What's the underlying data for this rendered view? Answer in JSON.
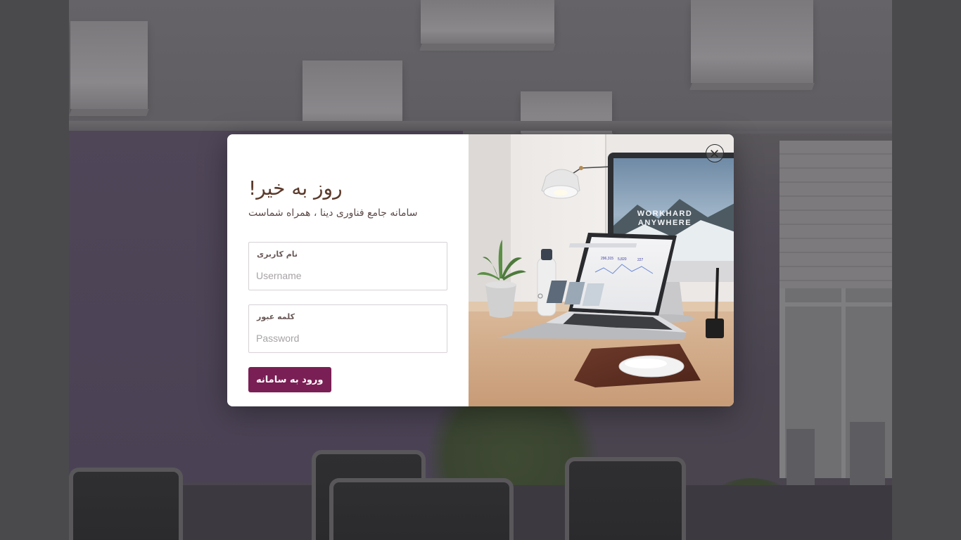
{
  "login": {
    "title": "روز به خیر!",
    "subtitle": "سامانه جامع فناوری دینا ، همراه شماست",
    "username": {
      "label": "نام کاربری",
      "placeholder": "Username",
      "value": ""
    },
    "password": {
      "label": "کلمه عبور",
      "placeholder": "Password",
      "value": ""
    },
    "submit_label": "ورود به سامانه"
  },
  "photo": {
    "screen_text_line1": "WORKHARD",
    "screen_text_line2": "ANYWHERE",
    "stats": [
      "296,315",
      "5,820",
      "227"
    ]
  },
  "colors": {
    "accent": "#7a1f55",
    "title": "#5b3a2b",
    "overlay": "#4a4a4c"
  },
  "icons": {
    "close": "close-circle-icon"
  }
}
